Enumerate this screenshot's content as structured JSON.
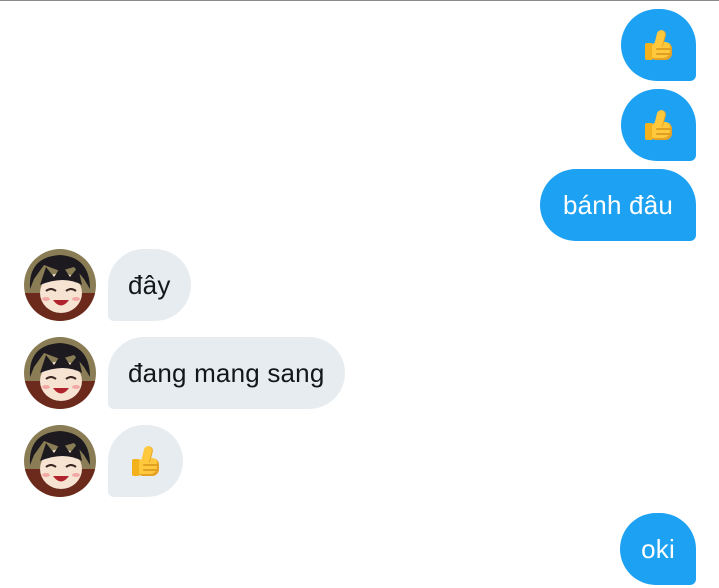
{
  "conversation": {
    "messages": [
      {
        "sender": "me",
        "kind": "emoji",
        "icon": "thumbs-up-icon"
      },
      {
        "sender": "me",
        "kind": "emoji",
        "icon": "thumbs-up-icon"
      },
      {
        "sender": "me",
        "kind": "text",
        "text": "bánh đâu"
      },
      {
        "sender": "other",
        "kind": "text",
        "text": "đây"
      },
      {
        "sender": "other",
        "kind": "text",
        "text": "đang mang sang"
      },
      {
        "sender": "other",
        "kind": "emoji",
        "icon": "thumbs-up-icon"
      },
      {
        "sender": "me",
        "kind": "text",
        "text": "oki"
      }
    ]
  },
  "colors": {
    "outgoing_bubble": "#1da1f2",
    "incoming_bubble": "#e6ecf0",
    "outgoing_text": "#ffffff",
    "incoming_text": "#14171a"
  }
}
